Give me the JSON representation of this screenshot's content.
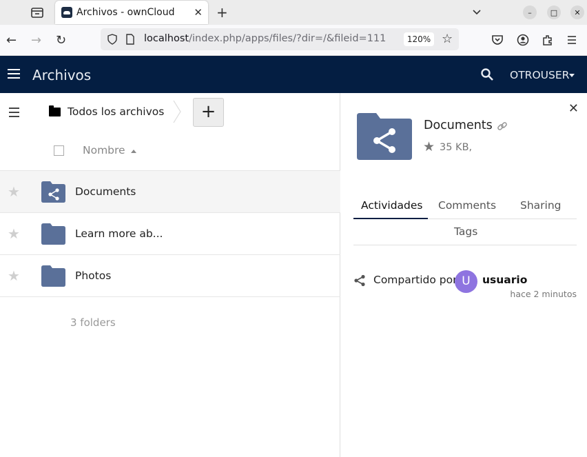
{
  "browser": {
    "tab_title": "Archivos - ownCloud",
    "url_host": "localhost",
    "url_path": "/index.php/apps/files/?dir=/&fileid=111",
    "zoom": "120%"
  },
  "header": {
    "app_title": "Archivos",
    "user": "OTROUSER"
  },
  "files": {
    "breadcrumb": "Todos los archivos",
    "new_label": "+",
    "column_name": "Nombre",
    "rows": [
      {
        "name": "Documents",
        "type": "shared-folder",
        "selected": true
      },
      {
        "name": "Learn more ab...",
        "type": "folder",
        "selected": false
      },
      {
        "name": "Photos",
        "type": "folder",
        "selected": false
      }
    ],
    "summary": "3 folders"
  },
  "details": {
    "name": "Documents",
    "size": "35 KB,",
    "tabs": [
      "Actividades",
      "Comments",
      "Sharing",
      "Tags"
    ],
    "active_tab": "Actividades",
    "activity": {
      "text": "Compartido por",
      "avatar_letter": "U",
      "user": "usuario",
      "time": "hace 2 minutos"
    }
  },
  "colors": {
    "header_bg": "#041e42",
    "folder": "#5a7099",
    "avatar": "#8e74e0"
  }
}
